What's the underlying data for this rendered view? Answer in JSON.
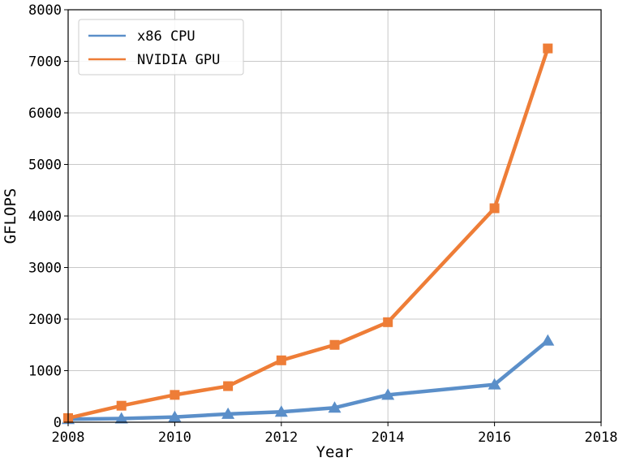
{
  "chart_data": {
    "type": "line",
    "title": "",
    "xlabel": "Year",
    "ylabel": "GFLOPS",
    "xlim": [
      2008,
      2018
    ],
    "ylim": [
      0,
      8000
    ],
    "x_ticks": [
      2008,
      2010,
      2012,
      2014,
      2016,
      2018
    ],
    "y_ticks": [
      0,
      1000,
      2000,
      3000,
      4000,
      5000,
      6000,
      7000,
      8000
    ],
    "grid": true,
    "legend_position": "top-left",
    "series": [
      {
        "name": "x86 CPU",
        "color": "#5b8fc9",
        "marker": "triangle",
        "x": [
          2008,
          2009,
          2010,
          2011,
          2012,
          2013,
          2014,
          2016,
          2017
        ],
        "y": [
          60,
          70,
          100,
          160,
          200,
          280,
          530,
          730,
          1580
        ]
      },
      {
        "name": "NVIDIA GPU",
        "color": "#ee7d37",
        "marker": "square",
        "x": [
          2008,
          2009,
          2010,
          2011,
          2012,
          2013,
          2014,
          2016,
          2017
        ],
        "y": [
          80,
          320,
          530,
          700,
          1200,
          1500,
          1940,
          4150,
          7250
        ]
      }
    ]
  }
}
